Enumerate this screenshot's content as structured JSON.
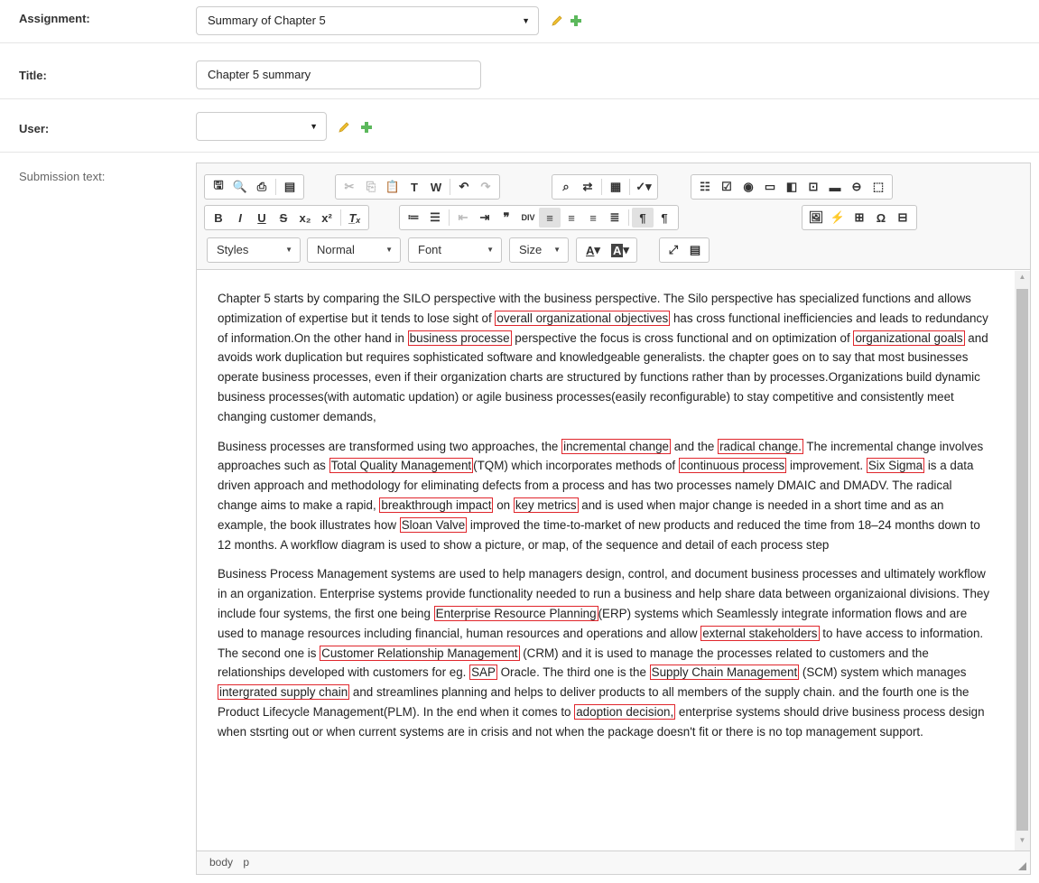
{
  "form": {
    "assignment_label": "Assignment:",
    "assignment_value": "Summary of Chapter 5",
    "title_label": "Title:",
    "title_value": "Chapter 5 summary",
    "user_label": "User:",
    "user_value": "",
    "submission_label": "Submission text:"
  },
  "toolbar": {
    "row3": {
      "styles": "Styles",
      "format": "Normal",
      "font": "Font",
      "size": "Size"
    }
  },
  "icons": [
    "save-icon",
    "preview-icon",
    "print-icon",
    "templates-icon",
    "cut-icon",
    "copy-icon",
    "paste-icon",
    "paste-text-icon",
    "paste-word-icon",
    "undo-icon",
    "redo-icon",
    "find-icon",
    "replace-icon",
    "select-all-icon",
    "spellcheck-icon",
    "form-icon",
    "checkbox-icon",
    "radio-icon",
    "textfield-icon",
    "textarea-icon",
    "select-icon",
    "button-icon",
    "imagebutton-icon",
    "hiddenfield-icon",
    "bold-icon",
    "italic-icon",
    "underline-icon",
    "strike-icon",
    "subscript-icon",
    "superscript-icon",
    "remove-format-icon",
    "numbered-list-icon",
    "bulleted-list-icon",
    "outdent-icon",
    "indent-icon",
    "blockquote-icon",
    "div-icon",
    "align-left-icon",
    "align-center-icon",
    "align-right-icon",
    "justify-icon",
    "ltr-icon",
    "rtl-icon",
    "image-icon",
    "flash-icon",
    "table-icon",
    "special-char-icon",
    "page-break-icon",
    "text-color-icon",
    "bg-color-icon",
    "maximize-icon",
    "show-blocks-icon"
  ],
  "content": {
    "p1": [
      {
        "t": "Chapter 5 starts by comparing the SILO perspective with the business perspective. The Silo perspective has specialized functions and allows optimization of expertise but it tends to lose sight of "
      },
      {
        "t": "overall organizational objectives",
        "m": true
      },
      {
        "t": " has cross functional inefficiencies and leads to redundancy of information.On the other hand  in "
      },
      {
        "t": "business processe",
        "m": true
      },
      {
        "t": " perspective the focus is cross functional and on optimization of "
      },
      {
        "t": "organizational goals",
        "m": true
      },
      {
        "t": " and avoids work duplication but requires sophisticated software and knowledgeable generalists. the chapter goes on to say that most businesses operate business processes, even if their organization charts are structured by functions rather than by processes.Organizations build dynamic business processes(with automatic updation) or agile business processes(easily reconfigurable) to stay competitive and consistently meet changing customer demands,"
      }
    ],
    "p2": [
      {
        "t": "Business processes are transformed using two approaches, the "
      },
      {
        "t": "incremental change",
        "m": true
      },
      {
        "t": " and the "
      },
      {
        "t": "radical change.",
        "m": true
      },
      {
        "t": " The incremental change involves approaches such as "
      },
      {
        "t": "Total Quality Management",
        "m": true
      },
      {
        "t": "(TQM) which incorporates methods of "
      },
      {
        "t": "continuous process",
        "m": true
      },
      {
        "t": " improvement. "
      },
      {
        "t": "Six Sigma",
        "m": true
      },
      {
        "t": " is a data driven approach and methodology for eliminating defects from a process and has two processes namely DMAIC and DMADV. The radical change aims to make a rapid, "
      },
      {
        "t": "breakthrough impact",
        "m": true
      },
      {
        "t": " on "
      },
      {
        "t": "key metrics",
        "m": true
      },
      {
        "t": " and is used when major change is needed in a short time and as an example, the book illustrates how "
      },
      {
        "t": "Sloan Valve",
        "m": true
      },
      {
        "t": " improved the time-to-market of new products and reduced the time from 18–24 months down to 12 months. A workflow diagram is used to show a picture, or map, of the sequence and detail of each process step"
      }
    ],
    "p3": [
      {
        "t": "Business Process Management systems are used to help managers design, control, and document business processes and ultimately workflow in an organization. Enterprise systems provide functionality needed to run a business and help share data between organizaional divisions. They include four systems, the first one being "
      },
      {
        "t": "Enterprise Resource Planning",
        "m": true
      },
      {
        "t": "(ERP) systems which Seamlessly integrate information flows and are used to manage resources including financial, human resources and operations and allow "
      },
      {
        "t": "external stakeholders",
        "m": true
      },
      {
        "t": " to have access to information. The second one is "
      },
      {
        "t": "Customer Relationship Management",
        "m": true
      },
      {
        "t": " (CRM) and it is used to manage the processes related to customers and the relationships developed with customers for eg. "
      },
      {
        "t": "SAP",
        "m": true
      },
      {
        "t": " Oracle. The third one is the "
      },
      {
        "t": "Supply Chain Management",
        "m": true
      },
      {
        "t": " (SCM) system which manages "
      },
      {
        "t": "intergrated supply chain",
        "m": true
      },
      {
        "t": " and streamlines planning and helps to deliver products to all members of the supply chain. and the fourth one is the Product Lifecycle Management(PLM). In the end when it comes to "
      },
      {
        "t": "adoption decision,",
        "m": true
      },
      {
        "t": " enterprise systems should drive business process design when stsrting out or when current systems are in crisis and not when the package doesn't fit or there is no top management support."
      }
    ]
  },
  "statusbar": {
    "path": [
      "body",
      "p"
    ]
  },
  "colors": {
    "highlight_border": "#e0262c",
    "plus_green": "#5cb85c",
    "pencil_yellow": "#f0c030"
  }
}
